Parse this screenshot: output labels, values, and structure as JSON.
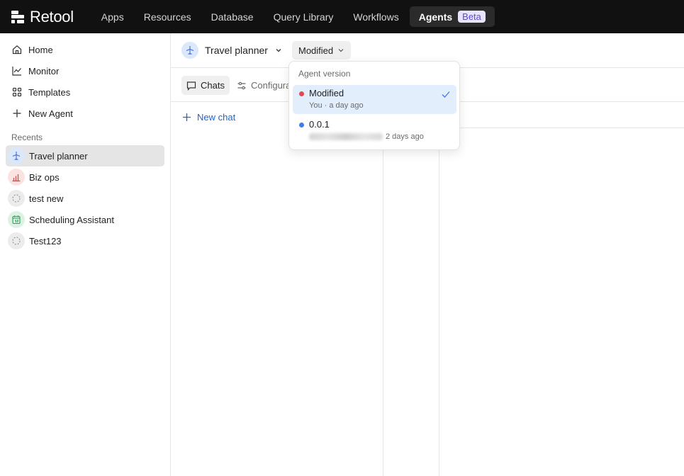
{
  "app": {
    "logo_text": "Retool",
    "nav": [
      {
        "label": "Apps"
      },
      {
        "label": "Resources"
      },
      {
        "label": "Database"
      },
      {
        "label": "Query Library"
      },
      {
        "label": "Workflows"
      }
    ],
    "active_nav": {
      "label": "Agents",
      "badge": "Beta"
    }
  },
  "sidebar": {
    "items": [
      {
        "label": "Home",
        "icon": "home-icon"
      },
      {
        "label": "Monitor",
        "icon": "chart-line-icon"
      },
      {
        "label": "Templates",
        "icon": "grid-icon"
      },
      {
        "label": "New Agent",
        "icon": "plus-icon"
      }
    ],
    "recents_label": "Recents",
    "recents": [
      {
        "label": "Travel planner",
        "icon": "airplane-icon",
        "active": true
      },
      {
        "label": "Biz ops",
        "icon": "bar-chart-icon"
      },
      {
        "label": "test new",
        "icon": "dashed-circle-icon"
      },
      {
        "label": "Scheduling Assistant",
        "icon": "calendar-icon"
      },
      {
        "label": "Test123",
        "icon": "dashed-circle-icon"
      }
    ]
  },
  "header": {
    "agent_name": "Travel planner",
    "version_button": "Modified"
  },
  "toolbar": {
    "chats_tab": "Chats",
    "config_tab": "Configura"
  },
  "chat_list": {
    "new_chat": "New chat"
  },
  "version_dropdown": {
    "label": "Agent version",
    "options": [
      {
        "title": "Modified",
        "subtitle": "You · a day ago",
        "dot_color": "#e5484d",
        "selected": true
      },
      {
        "title": "0.0.1",
        "subtitle": "2 days ago",
        "dot_color": "#3e7bf0",
        "selected": false
      }
    ]
  },
  "colors": {
    "topbar_bg": "#111111",
    "accent_blue": "#2563c9",
    "beta_badge_bg": "#e8e4ff",
    "selected_option_bg": "#e3eefc"
  }
}
